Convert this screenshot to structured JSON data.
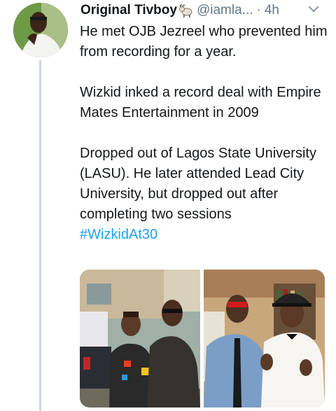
{
  "tweet": {
    "display_name": "Original Tivboy",
    "handle": "@iamla...",
    "separator": "·",
    "time": "4h",
    "badge_icon": "goat-emoji",
    "paragraphs": [
      "He met OJB Jezreel who prevented him from recording for a year.",
      "Wizkid inked a record deal with Empire Mates Entertainment in 2009",
      "Dropped out of Lagos State University (LASU). He later attended Lead City University, but dropped out after completing two sessions"
    ],
    "hashtag": "#WizkidAt30",
    "hashtag_color": "#1da1f2",
    "media": [
      {
        "name": "photo-wizkid-with-friend-outdoors",
        "icon": "photo"
      },
      {
        "name": "photo-wizkid-with-man-in-hat",
        "icon": "photo"
      }
    ]
  },
  "colors": {
    "text": "#14171a",
    "secondary": "#657786",
    "thread_line": "#ccd6dd"
  }
}
